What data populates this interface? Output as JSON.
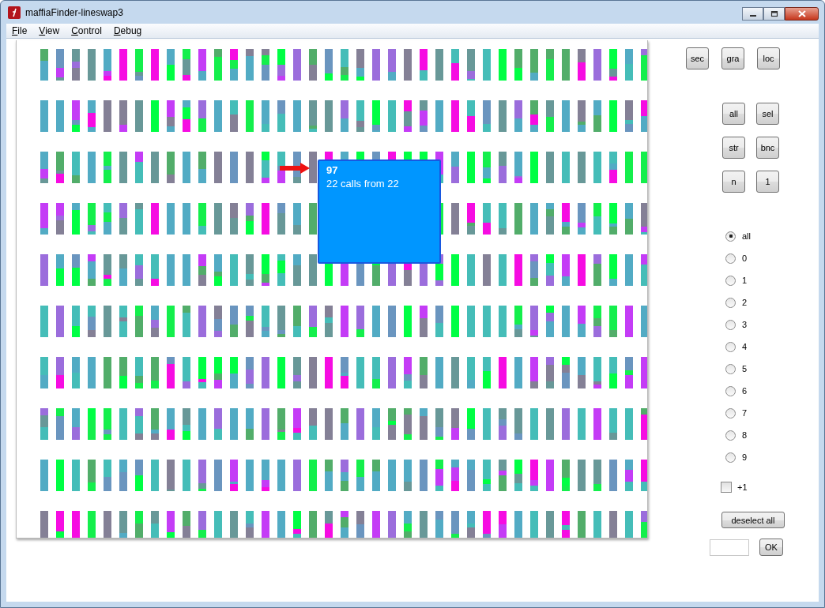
{
  "window": {
    "title": "maffiaFinder-lineswap3"
  },
  "menu": [
    "File",
    "View",
    "Control",
    "Debug"
  ],
  "canvas": {
    "tooltip": {
      "title": "97",
      "text": "22 calls from 22"
    }
  },
  "mode_buttons": [
    "sec",
    "gra",
    "loc"
  ],
  "action_buttons": [
    "all",
    "sel",
    "str",
    "bnc",
    "n",
    "1"
  ],
  "radios": [
    {
      "label": "all",
      "selected": true
    },
    {
      "label": "0",
      "selected": false
    },
    {
      "label": "1",
      "selected": false
    },
    {
      "label": "2",
      "selected": false
    },
    {
      "label": "3",
      "selected": false
    },
    {
      "label": "4",
      "selected": false
    },
    {
      "label": "5",
      "selected": false
    },
    {
      "label": "6",
      "selected": false
    },
    {
      "label": "7",
      "selected": false
    },
    {
      "label": "8",
      "selected": false
    },
    {
      "label": "9",
      "selected": false
    }
  ],
  "checkbox": {
    "label": "+1",
    "checked": false
  },
  "deselect_button": "deselect all",
  "ok_button": "OK"
}
